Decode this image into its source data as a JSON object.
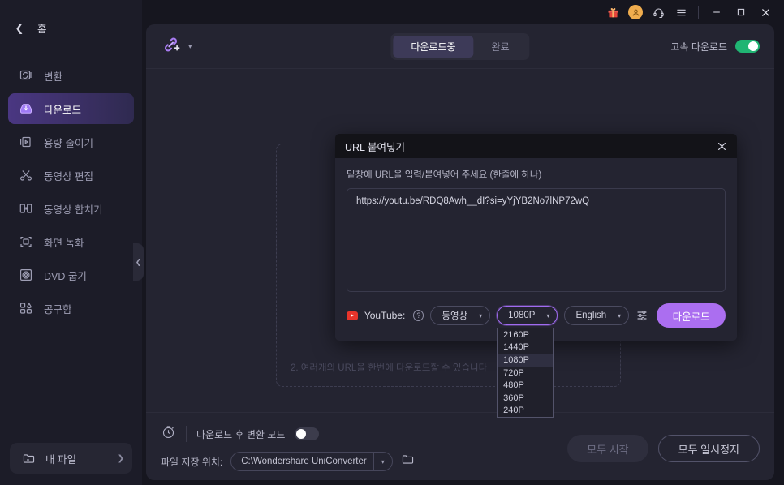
{
  "sidebar": {
    "home_label": "홈",
    "back_icon": "chevron-left-icon",
    "items": [
      {
        "label": "변환",
        "icon": "convert-icon"
      },
      {
        "label": "다운로드",
        "icon": "download-icon"
      },
      {
        "label": "용량 줄이기",
        "icon": "compress-icon"
      },
      {
        "label": "동영상 편집",
        "icon": "scissors-icon"
      },
      {
        "label": "동영상 합치기",
        "icon": "merge-icon"
      },
      {
        "label": "화면 녹화",
        "icon": "record-screen-icon"
      },
      {
        "label": "DVD 굽기",
        "icon": "dvd-burn-icon"
      },
      {
        "label": "공구함",
        "icon": "toolbox-icon"
      }
    ],
    "myfiles": {
      "label": "내 파일",
      "icon": "folder-icon",
      "arrow": "❯"
    },
    "collapse_handle": "❮"
  },
  "titlebar": {
    "gift_icon": "gift-icon",
    "avatar_icon": "user-avatar-icon",
    "support_icon": "headset-icon",
    "menu_icon": "hamburger-menu-icon",
    "minimize": "—",
    "maximize": "□",
    "close": "✕"
  },
  "toolbar": {
    "add_link_icon": "add-link-icon",
    "dropdown_caret": "▾",
    "tabs": [
      {
        "label": "다운로드중",
        "active": true
      },
      {
        "label": "완료",
        "active": false
      }
    ],
    "turbo": {
      "label": "고속 다운로드",
      "state": "on"
    }
  },
  "content": {
    "hint_text": "2. 여러개의 URL을 한번에 다운로드할 수 있습니다"
  },
  "bottombar": {
    "timer_icon": "timer-icon",
    "convert_after_download": {
      "label": "다운로드 후 변환 모드",
      "state": "off"
    },
    "save_location_label": "파일 저장 위치:",
    "save_location_value": "C:\\Wondershare UniConverter",
    "save_location_caret": "▾",
    "folder_icon": "folder-open-icon",
    "start_all": "모두 시작",
    "pause_all": "모두 일시정지"
  },
  "modal": {
    "title": "URL 붙여넣기",
    "close_icon": "close-icon",
    "hint": "밑창에 URL을 입력/붙여넣어 주세요 (한줄에 하나)",
    "url_value": "https://youtu.be/RDQ8Awh__dI?si=yYjYB2No7lNP72wQ",
    "url_placeholder": "",
    "source_label": "YouTube:",
    "help_icon": "question-mark-icon",
    "format_select": {
      "value": "동영상",
      "caret": "▾"
    },
    "quality_select": {
      "value": "1080P",
      "caret": "▾"
    },
    "language_select": {
      "value": "English",
      "caret": "▾"
    },
    "settings_icon": "sliders-icon",
    "download_button": "다운로드",
    "quality_options": [
      {
        "label": "2160P",
        "selected": false
      },
      {
        "label": "1440P",
        "selected": false
      },
      {
        "label": "1080P",
        "selected": true
      },
      {
        "label": "720P",
        "selected": false
      },
      {
        "label": "480P",
        "selected": false
      },
      {
        "label": "360P",
        "selected": false
      },
      {
        "label": "240P",
        "selected": false
      }
    ]
  },
  "colors": {
    "accent_purple": "#ab6ef0",
    "toggle_on_green": "#20b573",
    "panel_bg": "#242431",
    "sidebar_bg": "#1c1c28",
    "window_bg": "#16161f"
  }
}
